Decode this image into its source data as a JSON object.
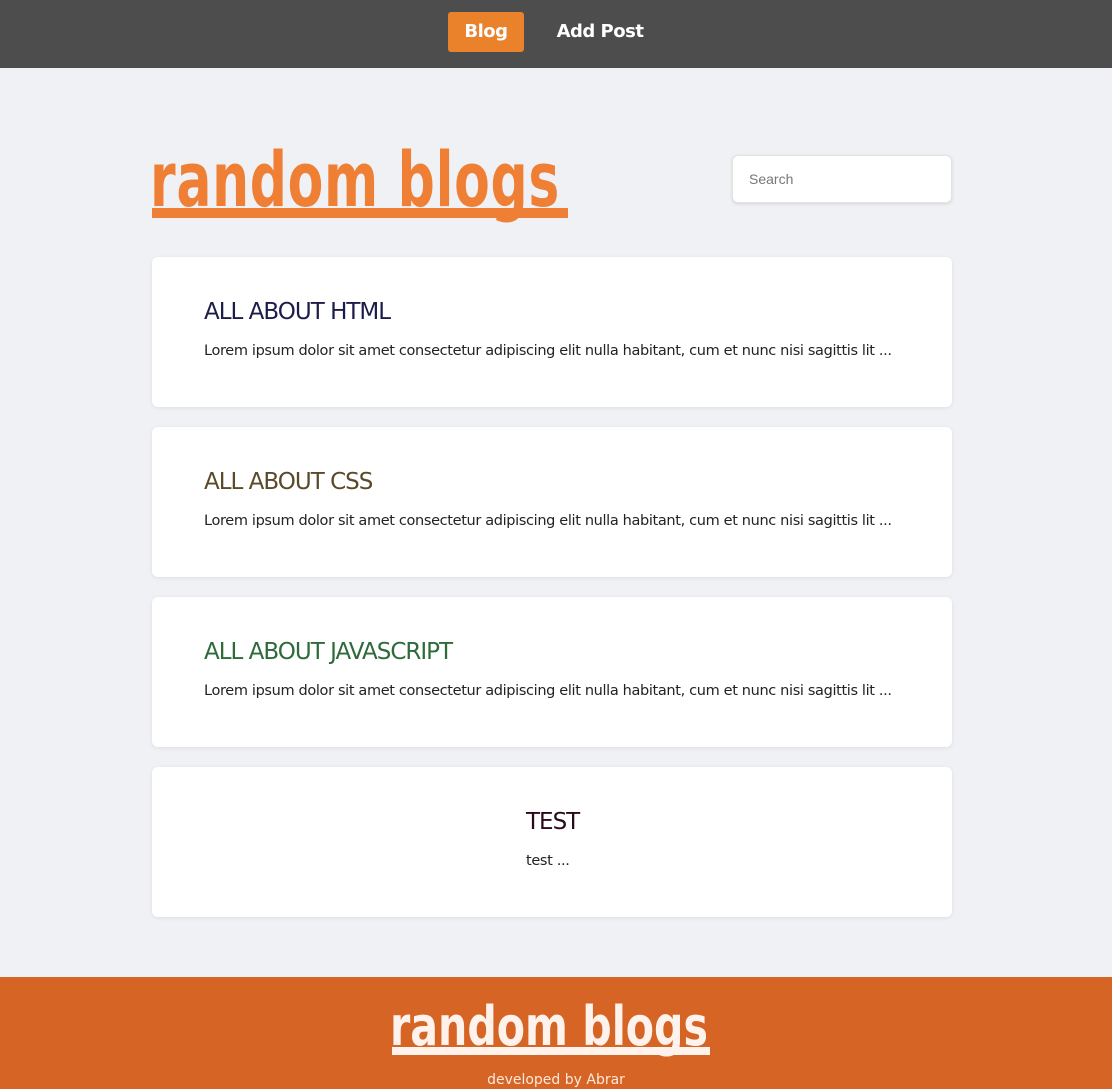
{
  "nav": {
    "blog_label": "Blog",
    "add_post_label": "Add Post"
  },
  "header": {
    "logo_text": "random blogs"
  },
  "search": {
    "placeholder": "Search",
    "value": ""
  },
  "posts": [
    {
      "title": "ALL ABOUT HTML",
      "excerpt": "Lorem ipsum dolor sit amet consectetur adipiscing elit nulla habitant, cum et nunc nisi sagittis lit ...",
      "title_color": "#1c1c4a"
    },
    {
      "title": "ALL ABOUT CSS",
      "excerpt": "Lorem ipsum dolor sit amet consectetur adipiscing elit nulla habitant, cum et nunc nisi sagittis lit ...",
      "title_color": "#5a4a2a"
    },
    {
      "title": "ALL ABOUT JAVASCRIPT",
      "excerpt": "Lorem ipsum dolor sit amet consectetur adipiscing elit nulla habitant, cum et nunc nisi sagittis lit ...",
      "title_color": "#2e6a3a"
    },
    {
      "title": "TEST",
      "excerpt": "test ...",
      "title_color": "#2a0a1a"
    }
  ],
  "footer": {
    "logo_text": "random blogs",
    "credit": "developed by Abrar"
  },
  "colors": {
    "nav_bg": "#4d4d4d",
    "accent": "#e9822b",
    "logo": "#ef7f35",
    "footer_bg": "#d66424",
    "page_bg": "#f0f1f4"
  }
}
